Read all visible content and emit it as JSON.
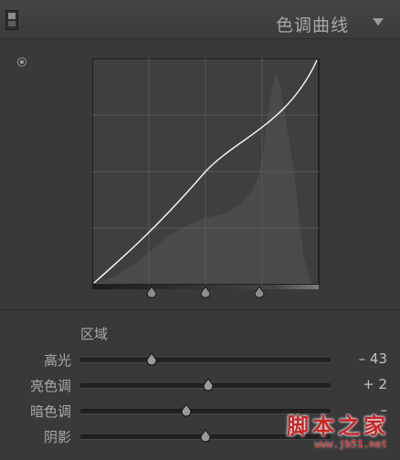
{
  "header": {
    "title": "色调曲线"
  },
  "section": {
    "label": "区域"
  },
  "sliders": [
    {
      "label": "高光",
      "value": "– 43",
      "level": -43
    },
    {
      "label": "亮色调",
      "value": "+ 2",
      "level": 2
    },
    {
      "label": "暗色调",
      "value": "–",
      "level": -15
    },
    {
      "label": "阴影",
      "value": "",
      "level": 0
    }
  ],
  "curve": {
    "split_points": [
      25,
      50,
      75
    ]
  },
  "watermark": {
    "text": "脚本之家",
    "url": "www.jb51.net"
  },
  "colors": {
    "background": "#393939",
    "graph": "#3f3f3f",
    "curve": "#f2f2f2",
    "histogram": "#4f4f4f"
  }
}
